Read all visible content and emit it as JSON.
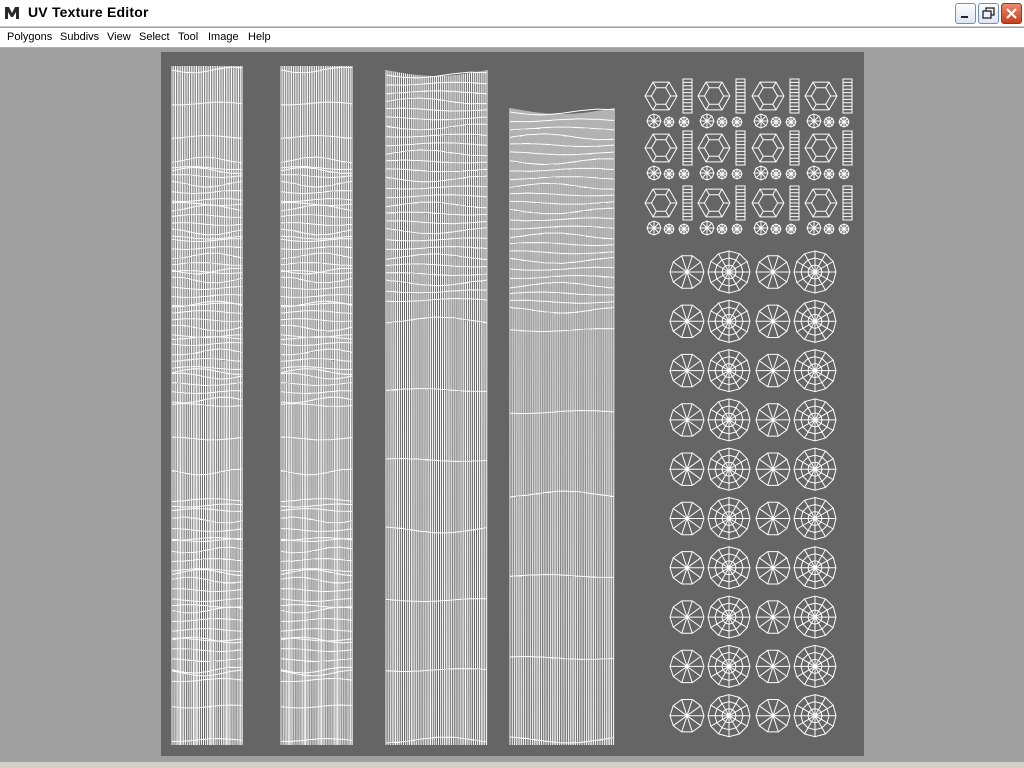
{
  "window": {
    "title": "UV Texture Editor"
  },
  "menubar": {
    "items": [
      "Polygons",
      "Subdivs",
      "View",
      "Select",
      "Tool",
      "Image",
      "Help"
    ]
  },
  "colors": {
    "canvas": "#656565",
    "wire": "#ffffff",
    "viewport_bg": "#a0a0a0"
  },
  "icons": {
    "app": "maya-app-icon",
    "minimize": "minimize-icon",
    "maximize": "maximize-icon",
    "close": "close-icon"
  }
}
